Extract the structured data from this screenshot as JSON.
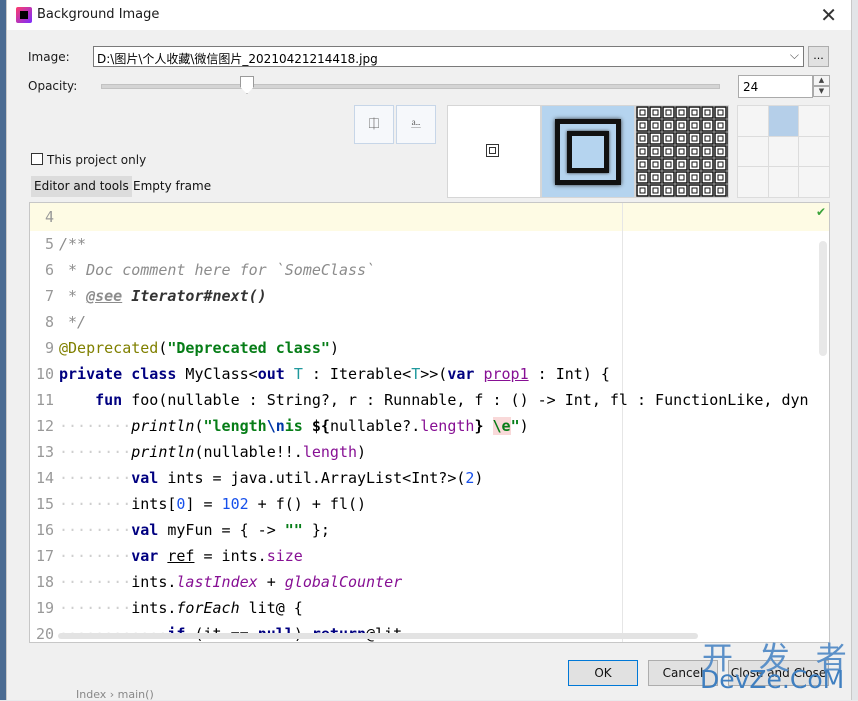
{
  "dialog": {
    "title": "Background Image",
    "close_glyph": "✕"
  },
  "image": {
    "label": "Image:",
    "path": "D:\\图片\\个人收藏\\微信图片_20210421214418.jpg",
    "browse_label": "...",
    "dropdown_glyph": "⌵"
  },
  "opacity": {
    "label": "Opacity:",
    "value": "24",
    "slider_fraction": 0.24
  },
  "flip_buttons": [
    {
      "name": "flip-horizontal-icon",
      "glyph": "⎅"
    },
    {
      "name": "flip-vertical-icon",
      "glyph": "⎁"
    }
  ],
  "fill_options": [
    "plain",
    "scale",
    "tile"
  ],
  "anchor_selected": 1,
  "this_project_only": {
    "label": "This project only",
    "checked": false
  },
  "tabs": [
    {
      "label": "Editor and tools",
      "active": true
    },
    {
      "label": "Empty frame",
      "active": false
    }
  ],
  "editor": {
    "line_numbers": [
      "4",
      "5",
      "6",
      "7",
      "8",
      "9",
      "10",
      "11",
      "12",
      "13",
      "14",
      "15",
      "16",
      "17",
      "18",
      "19",
      "20"
    ],
    "status_icon": "check-icon"
  },
  "buttons": {
    "ok": "OK",
    "cancel": "Cancel",
    "close": "Close and Close"
  },
  "watermark": {
    "top": "开 发 者",
    "bottom": "DevZe.CoM"
  },
  "background": {
    "footer_text": "Index  ›  main()"
  }
}
